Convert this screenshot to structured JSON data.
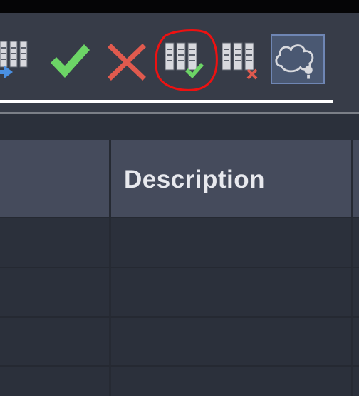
{
  "toolbar": {
    "buttons": [
      {
        "icon": "column-export-icon",
        "active": false
      },
      {
        "icon": "checkmark-icon",
        "active": false
      },
      {
        "icon": "close-x-icon",
        "active": false
      },
      {
        "icon": "columns-apply-icon",
        "active": false,
        "highlighted_by_annotation": true
      },
      {
        "icon": "columns-remove-icon",
        "active": false
      },
      {
        "icon": "cloud-info-icon",
        "active": true
      }
    ]
  },
  "grid": {
    "columns": [
      "",
      "Description",
      ""
    ],
    "rows": [
      [
        "",
        "",
        ""
      ],
      [
        "",
        "",
        ""
      ],
      [
        "",
        "",
        ""
      ],
      [
        "",
        "",
        ""
      ]
    ]
  },
  "colors": {
    "check_green": "#6cd466",
    "cross_red": "#e05a4e",
    "accent_blue": "#4a90e2",
    "annotation_red": "#ee1111",
    "header_bg": "#454b5c"
  }
}
